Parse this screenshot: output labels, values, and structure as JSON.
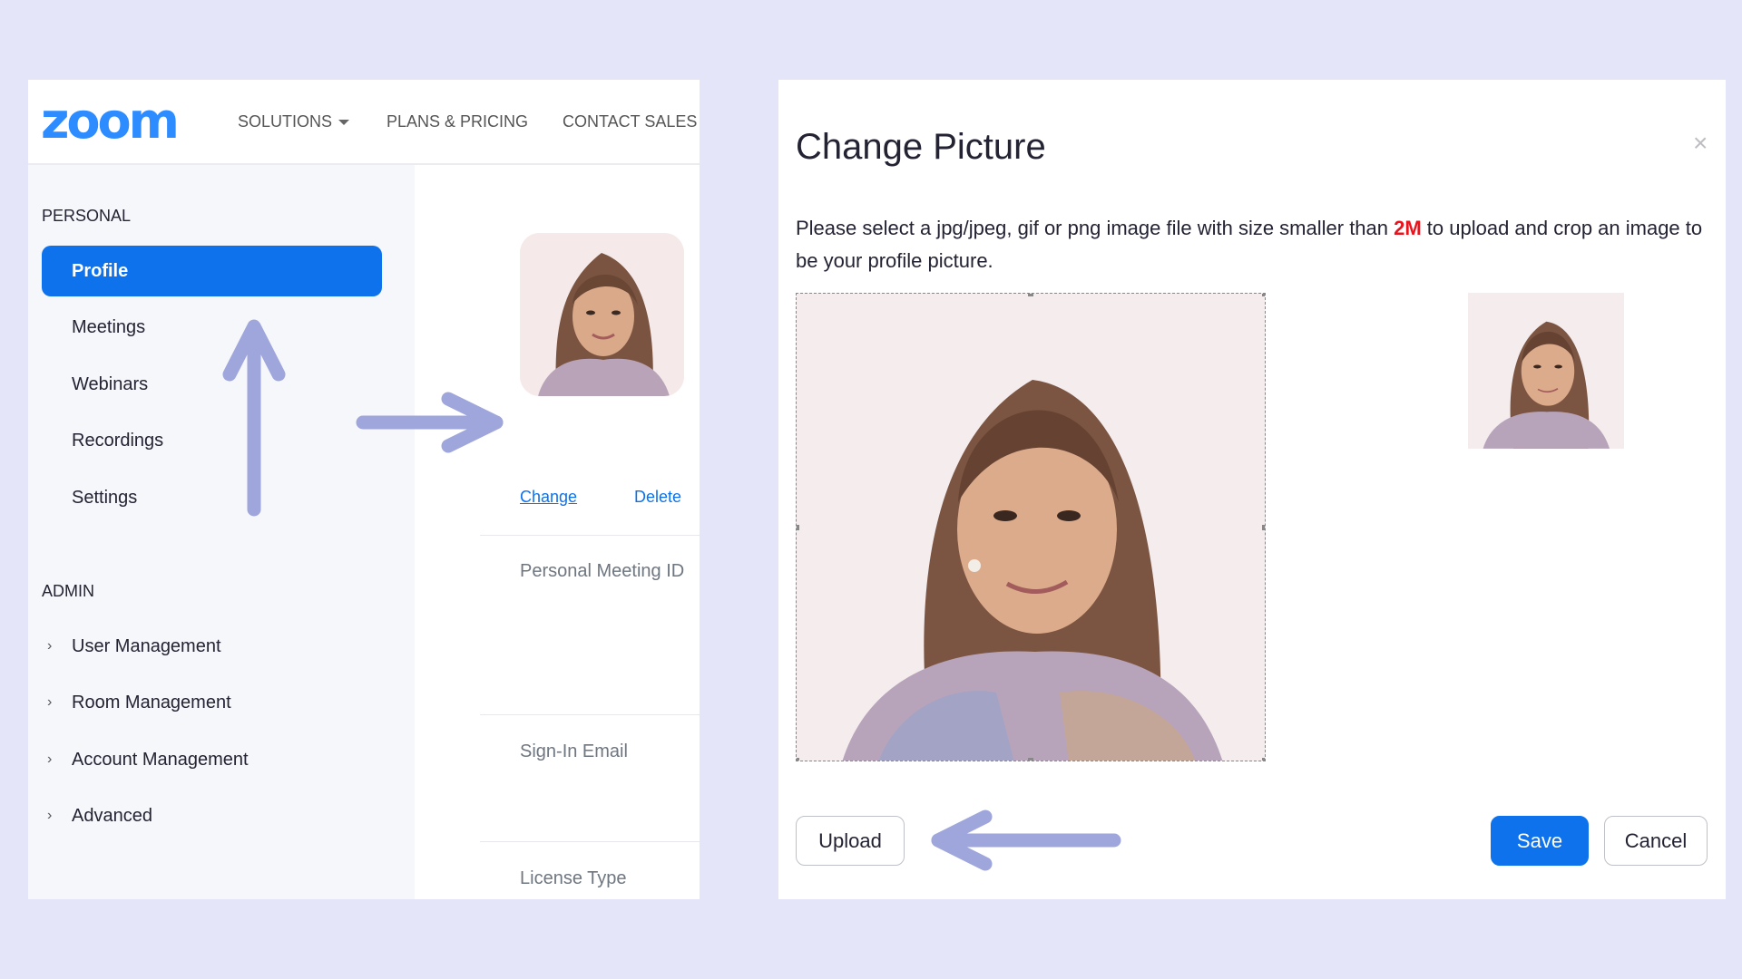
{
  "header": {
    "logo": "zoom",
    "nav": [
      {
        "label": "SOLUTIONS",
        "has_dropdown": true
      },
      {
        "label": "PLANS & PRICING",
        "has_dropdown": false
      },
      {
        "label": "CONTACT SALES",
        "has_dropdown": false
      }
    ]
  },
  "sidebar": {
    "personal_label": "PERSONAL",
    "personal_items": [
      {
        "label": "Profile",
        "active": true
      },
      {
        "label": "Meetings"
      },
      {
        "label": "Webinars"
      },
      {
        "label": "Recordings"
      },
      {
        "label": "Settings"
      }
    ],
    "admin_label": "ADMIN",
    "admin_items": [
      {
        "label": "User Management"
      },
      {
        "label": "Room Management"
      },
      {
        "label": "Account Management"
      },
      {
        "label": "Advanced"
      }
    ]
  },
  "profile": {
    "change_link": "Change",
    "delete_link": "Delete",
    "fields": [
      "Personal Meeting ID",
      "Sign-In Email",
      "License Type"
    ]
  },
  "dialog": {
    "title": "Change Picture",
    "close_icon": "×",
    "description_before": "Please select a jpg/jpeg, gif or png image file with size smaller than ",
    "description_highlight": "2M",
    "description_after": " to upload and crop an image to be your profile picture.",
    "upload_label": "Upload",
    "save_label": "Save",
    "cancel_label": "Cancel"
  },
  "colors": {
    "brand": "#2d8cff",
    "primary": "#0e72ed",
    "highlight": "#e8141d",
    "annotation_arrow": "#9ea6dc",
    "background": "#e4e5f8"
  }
}
